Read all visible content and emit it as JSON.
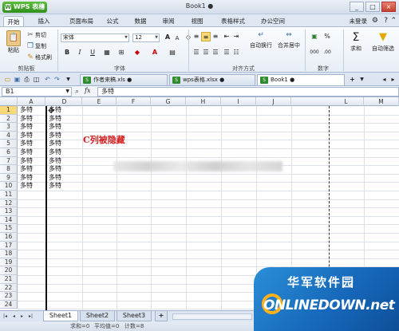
{
  "title_bar": {
    "app_button": "WPS 表格",
    "window_title": "Book1 ●",
    "controls": [
      "_",
      "□",
      "×"
    ]
  },
  "menu": {
    "tabs": [
      "开始",
      "插入",
      "页面布局",
      "公式",
      "数据",
      "审阅",
      "视图",
      "表格样式",
      "办公空间"
    ],
    "user": "未登录"
  },
  "ribbon": {
    "paste": "粘贴",
    "cut": "剪切",
    "copy": "复制",
    "format_painter": "格式刷",
    "clipboard_label": "剪贴板",
    "font_name": "宋体",
    "font_size": "12",
    "bold": "B",
    "italic": "I",
    "underline": "U",
    "font_label": "字体",
    "wrap_text": "自动换行",
    "merge_center": "合并居中",
    "align_label": "对齐方式",
    "number_label": "数字",
    "percent": "%",
    "sum": "求和",
    "filter": "自动筛选"
  },
  "doc_tabs": [
    {
      "label": "作者来稿.xls ●"
    },
    {
      "label": "wps表格.xlsx ●"
    },
    {
      "label": "Book1 ●"
    }
  ],
  "formula_bar": {
    "cell_ref": "B1",
    "fx": "fx",
    "value": "多特"
  },
  "columns": [
    "A",
    "D",
    "E",
    "F",
    "G",
    "H",
    "I",
    "J",
    "L",
    "M"
  ],
  "rows": [
    "1",
    "2",
    "3",
    "4",
    "5",
    "6",
    "7",
    "8",
    "9",
    "10",
    "11",
    "12",
    "13",
    "14",
    "15",
    "16",
    "17",
    "18",
    "19",
    "20",
    "21",
    "22",
    "23",
    "24"
  ],
  "cells": {
    "col_a": [
      "多特",
      "多特",
      "多特",
      "多特",
      "多特",
      "多特",
      "多特",
      "多特",
      "多特",
      "多特"
    ],
    "col_d": [
      "多特",
      "多特",
      "多特",
      "多特",
      "多特",
      "多特",
      "多特",
      "多特",
      "多特",
      "多特"
    ]
  },
  "annotation": "C列被隐藏",
  "sheet_tabs": [
    "Sheet1",
    "Sheet2",
    "Sheet3"
  ],
  "add_sheet": "+",
  "status_bar": {
    "sum": "求和=0",
    "avg": "平均值=0",
    "count": "计数=8"
  },
  "watermark": {
    "cn": "华军软件园",
    "en": "ONLINEDOWN.net"
  }
}
